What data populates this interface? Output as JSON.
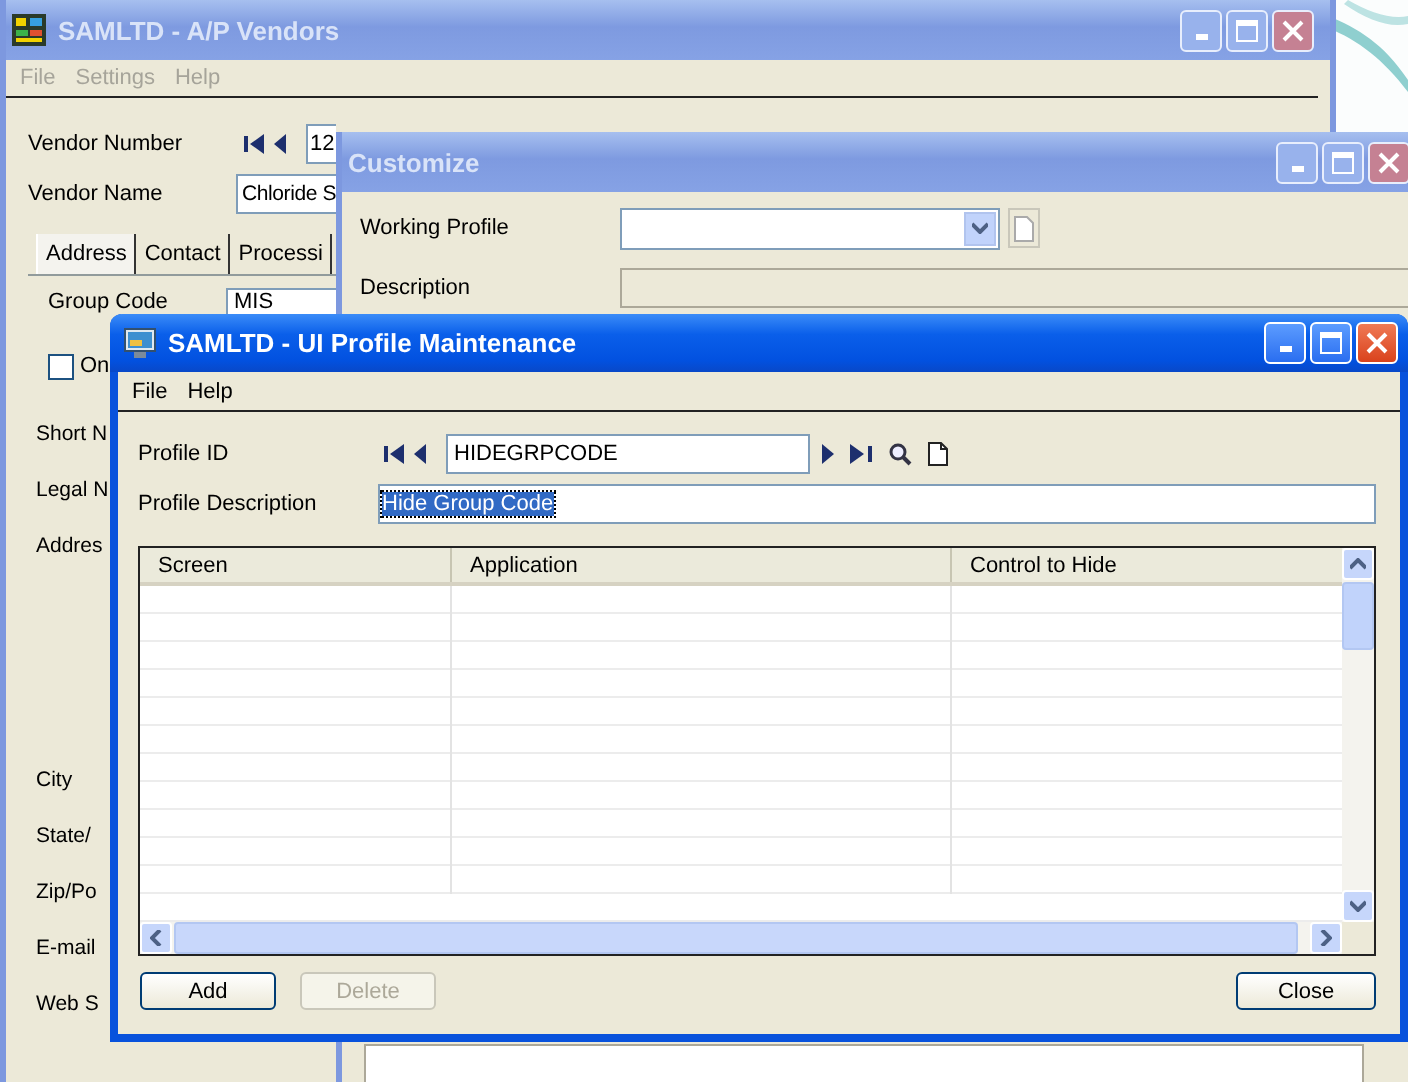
{
  "vendors_window": {
    "title": "SAMLTD - A/P Vendors",
    "active": false,
    "menu": [
      "File",
      "Settings",
      "Help"
    ],
    "vendor_number": {
      "label": "Vendor Number",
      "value": "12"
    },
    "vendor_name": {
      "label": "Vendor Name",
      "value": "Chloride S"
    },
    "tabs": [
      {
        "label": "Address",
        "selected": true
      },
      {
        "label": "Contact",
        "selected": false
      },
      {
        "label": "Processi",
        "selected": false
      }
    ],
    "group_code": {
      "label": "Group Code",
      "value": "MIS"
    },
    "checkbox": {
      "label": "On",
      "checked": false
    },
    "labels": [
      "Short N",
      "Legal N",
      "Addres",
      "City",
      "State/",
      "Zip/Po",
      "E-mail",
      "Web S"
    ]
  },
  "customize_window": {
    "title": "Customize",
    "active": false,
    "working_profile_label": "Working Profile",
    "description_label": "Description"
  },
  "profile_window": {
    "title": "SAMLTD - UI Profile Maintenance",
    "active": true,
    "menu": [
      "File",
      "Help"
    ],
    "profile_id": {
      "label": "Profile ID",
      "value": "HIDEGRPCODE"
    },
    "profile_description": {
      "label": "Profile Description",
      "value": "Hide Group Code",
      "selected": true
    },
    "table": {
      "columns": [
        "Screen",
        "Application",
        "Control to Hide"
      ]
    },
    "buttons": [
      {
        "label": "Add",
        "disabled": false
      },
      {
        "label": "Delete",
        "disabled": true
      },
      {
        "label": "Close",
        "disabled": false
      }
    ]
  }
}
